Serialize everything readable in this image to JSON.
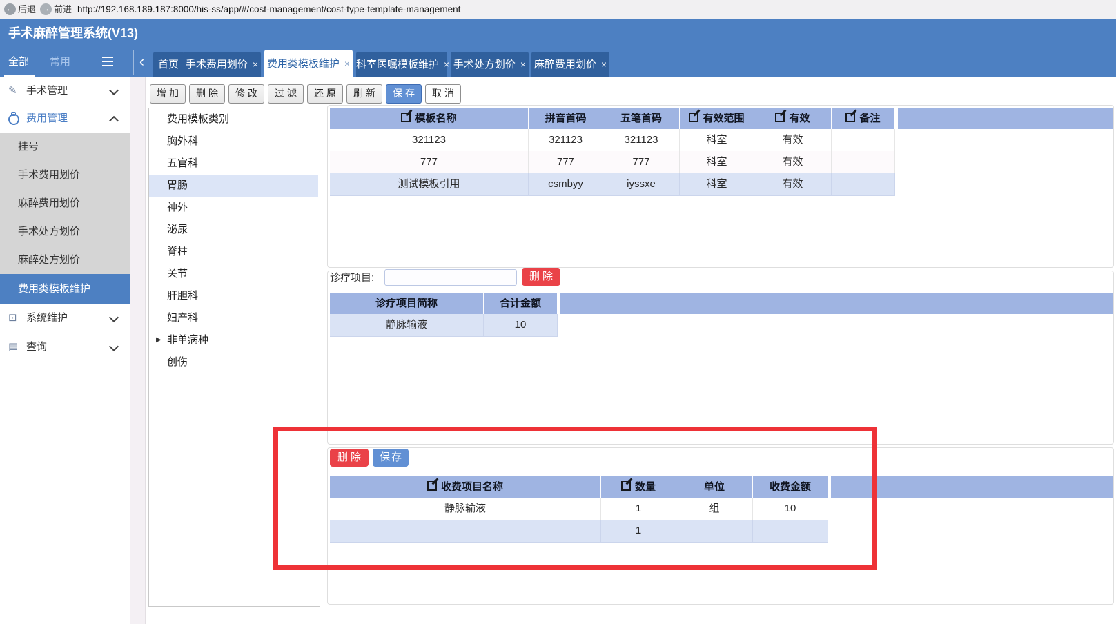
{
  "colors": {
    "accent_blue": "#4d80c2",
    "tab_inactive_blue": "#30609d",
    "table_header_blue": "#9fb4e2",
    "row_selected_blue": "#dae3f5",
    "category_selected_blue": "#dce5f7",
    "danger_red": "#ea4248",
    "primary_button_blue": "#6190d4",
    "annotation_red": "#ee3237"
  },
  "browser": {
    "back": "后退",
    "forward": "前进",
    "url": "http://192.168.189.187:8000/his-ss/app/#/cost-management/cost-type-template-management"
  },
  "app_title": "手术麻醉管理系统(V13)",
  "nav": {
    "sidebar_tabs": [
      {
        "label": "全部",
        "active": true
      },
      {
        "label": "常用",
        "active": false
      }
    ],
    "back_chevron": "‹",
    "close_glyph": "×",
    "tabs": [
      {
        "label": "首页",
        "closable": false,
        "active": false
      },
      {
        "label": "手术费用划价",
        "closable": true,
        "active": false
      },
      {
        "label": "费用类模板维护",
        "closable": true,
        "active": true
      },
      {
        "label": "科室医嘱模板维护",
        "closable": true,
        "active": false
      },
      {
        "label": "手术处方划价",
        "closable": true,
        "active": false
      },
      {
        "label": "麻醉费用划价",
        "closable": true,
        "active": false
      }
    ]
  },
  "sidebar": {
    "items": [
      {
        "label": "手术管理",
        "icon": "pen-icon",
        "state": "collapsed"
      },
      {
        "label": "费用管理",
        "icon": "cost-icon",
        "state": "expanded"
      },
      {
        "label": "挂号"
      },
      {
        "label": "手术费用划价"
      },
      {
        "label": "麻醉费用划价"
      },
      {
        "label": "手术处方划价"
      },
      {
        "label": "麻醉处方划价"
      },
      {
        "label": "费用类模板维护",
        "active": true
      },
      {
        "label": "系统维护",
        "icon": "monitor-icon",
        "state": "collapsed"
      },
      {
        "label": "查询",
        "icon": "query-icon",
        "state": "collapsed"
      }
    ]
  },
  "toolbar": {
    "buttons": [
      {
        "label": "增加",
        "variant": "default"
      },
      {
        "label": "删除",
        "variant": "default"
      },
      {
        "label": "修改",
        "variant": "default"
      },
      {
        "label": "过滤",
        "variant": "default"
      },
      {
        "label": "还原",
        "variant": "default"
      },
      {
        "label": "刷新",
        "variant": "default"
      },
      {
        "label": "保存",
        "variant": "primary"
      },
      {
        "label": "取消",
        "variant": "plain"
      }
    ]
  },
  "categories": {
    "items": [
      {
        "label": "费用模板类别"
      },
      {
        "label": "胸外科"
      },
      {
        "label": "五官科"
      },
      {
        "label": "胃肠",
        "selected": true
      },
      {
        "label": "神外"
      },
      {
        "label": "泌尿"
      },
      {
        "label": "脊柱"
      },
      {
        "label": "关节"
      },
      {
        "label": "肝胆科"
      },
      {
        "label": "妇产科"
      },
      {
        "label": "非单病种",
        "expandable": true
      },
      {
        "label": "创伤"
      }
    ]
  },
  "template_table": {
    "columns": [
      {
        "label": "模板名称",
        "editable": true
      },
      {
        "label": "拼音首码",
        "editable": false
      },
      {
        "label": "五笔首码",
        "editable": false
      },
      {
        "label": "有效范围",
        "editable": true
      },
      {
        "label": "有效",
        "editable": true
      },
      {
        "label": "备注",
        "editable": true
      }
    ],
    "rows": [
      [
        "321123",
        "321123",
        "321123",
        "科室",
        "有效",
        ""
      ],
      [
        "777",
        "777",
        "777",
        "科室",
        "有效",
        ""
      ],
      [
        "测试模板引用",
        "csmbyy",
        "iyssxe",
        "科室",
        "有效",
        ""
      ]
    ],
    "selected_row_index": 2
  },
  "treatment": {
    "label": "诊疗项目:",
    "input_value": "",
    "delete_button": "删除",
    "table": {
      "columns": [
        {
          "label": "诊疗项目简称"
        },
        {
          "label": "合计金额"
        }
      ],
      "rows": [
        [
          "静脉输液",
          "10"
        ]
      ],
      "selected_row_index": 0
    }
  },
  "charge": {
    "delete_button": "删除",
    "save_button": "保存",
    "table": {
      "columns": [
        {
          "label": "收费项目名称",
          "editable": true
        },
        {
          "label": "数量",
          "editable": true
        },
        {
          "label": "单位",
          "editable": false
        },
        {
          "label": "收费金额",
          "editable": false
        }
      ],
      "rows": [
        [
          "静脉输液",
          "1",
          "组",
          "10"
        ],
        [
          "",
          "1",
          "",
          ""
        ]
      ],
      "selected_row_index": 1
    }
  }
}
